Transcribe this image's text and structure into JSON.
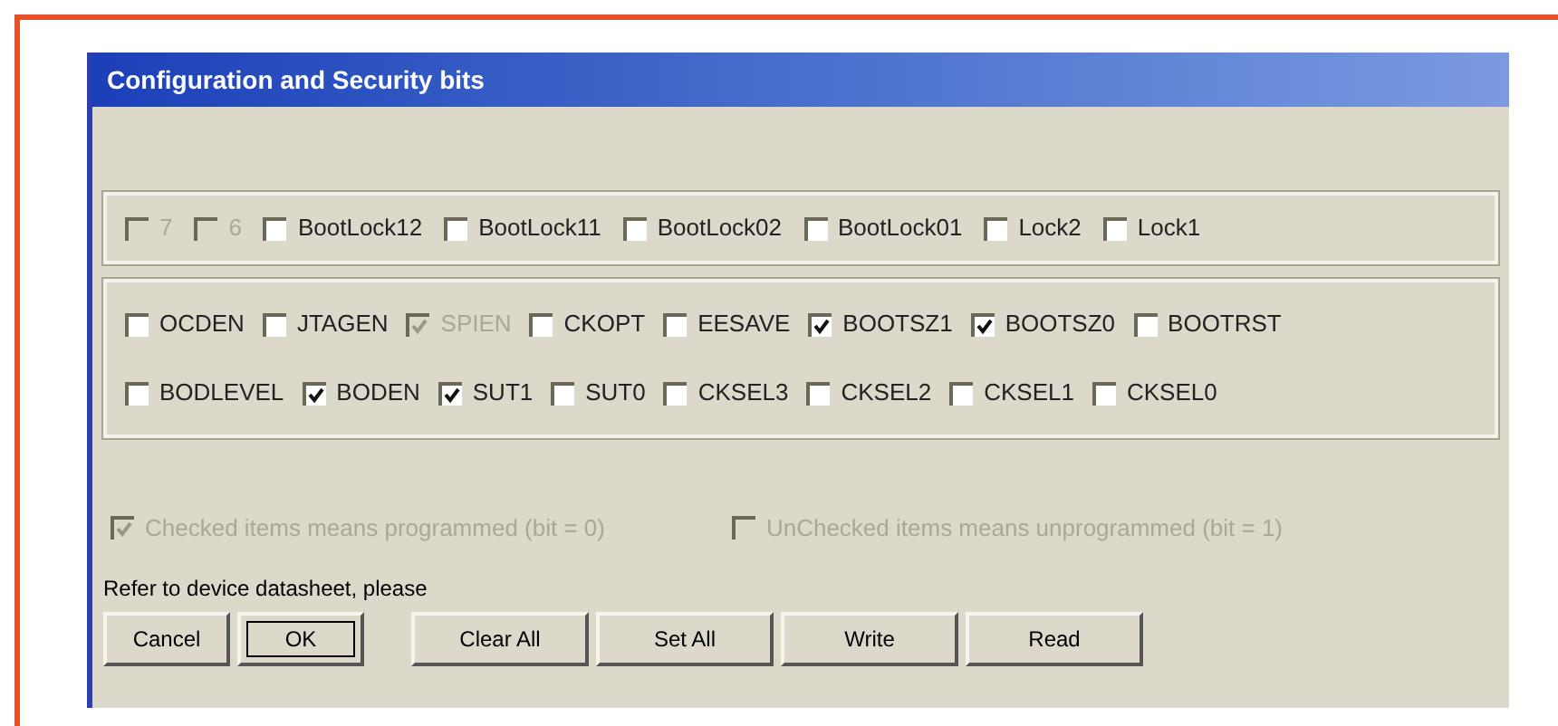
{
  "window": {
    "title": "Configuration and Security bits"
  },
  "lock_bits": [
    {
      "label": "7",
      "checked": false,
      "disabled": true
    },
    {
      "label": "6",
      "checked": false,
      "disabled": true
    },
    {
      "label": "BootLock12",
      "checked": false,
      "disabled": false
    },
    {
      "label": "BootLock11",
      "checked": false,
      "disabled": false
    },
    {
      "label": "BootLock02",
      "checked": false,
      "disabled": false
    },
    {
      "label": "BootLock01",
      "checked": false,
      "disabled": false
    },
    {
      "label": "Lock2",
      "checked": false,
      "disabled": false
    },
    {
      "label": "Lock1",
      "checked": false,
      "disabled": false
    }
  ],
  "fuse_rows": [
    [
      {
        "label": "OCDEN",
        "checked": false,
        "disabled": false
      },
      {
        "label": "JTAGEN",
        "checked": false,
        "disabled": false
      },
      {
        "label": "SPIEN",
        "checked": true,
        "disabled": true
      },
      {
        "label": "CKOPT",
        "checked": false,
        "disabled": false
      },
      {
        "label": "EESAVE",
        "checked": false,
        "disabled": false
      },
      {
        "label": "BOOTSZ1",
        "checked": true,
        "disabled": false
      },
      {
        "label": "BOOTSZ0",
        "checked": true,
        "disabled": false
      },
      {
        "label": "BOOTRST",
        "checked": false,
        "disabled": false
      }
    ],
    [
      {
        "label": "BODLEVEL",
        "checked": false,
        "disabled": false
      },
      {
        "label": "BODEN",
        "checked": true,
        "disabled": false
      },
      {
        "label": "SUT1",
        "checked": true,
        "disabled": false
      },
      {
        "label": "SUT0",
        "checked": false,
        "disabled": false
      },
      {
        "label": "CKSEL3",
        "checked": false,
        "disabled": false
      },
      {
        "label": "CKSEL2",
        "checked": false,
        "disabled": false
      },
      {
        "label": "CKSEL1",
        "checked": false,
        "disabled": false
      },
      {
        "label": "CKSEL0",
        "checked": false,
        "disabled": false
      }
    ]
  ],
  "legend": [
    {
      "label": "Checked items means programmed (bit = 0)",
      "checked": true,
      "disabled": true
    },
    {
      "label": "UnChecked items means unprogrammed (bit = 1)",
      "checked": false,
      "disabled": true
    }
  ],
  "note": "Refer to device datasheet, please",
  "buttons": [
    {
      "label": "Cancel",
      "default": false
    },
    {
      "label": "OK",
      "default": true
    },
    {
      "label": "Clear All",
      "default": false
    },
    {
      "label": "Set All",
      "default": false
    },
    {
      "label": "Write",
      "default": false
    },
    {
      "label": "Read",
      "default": false
    }
  ]
}
